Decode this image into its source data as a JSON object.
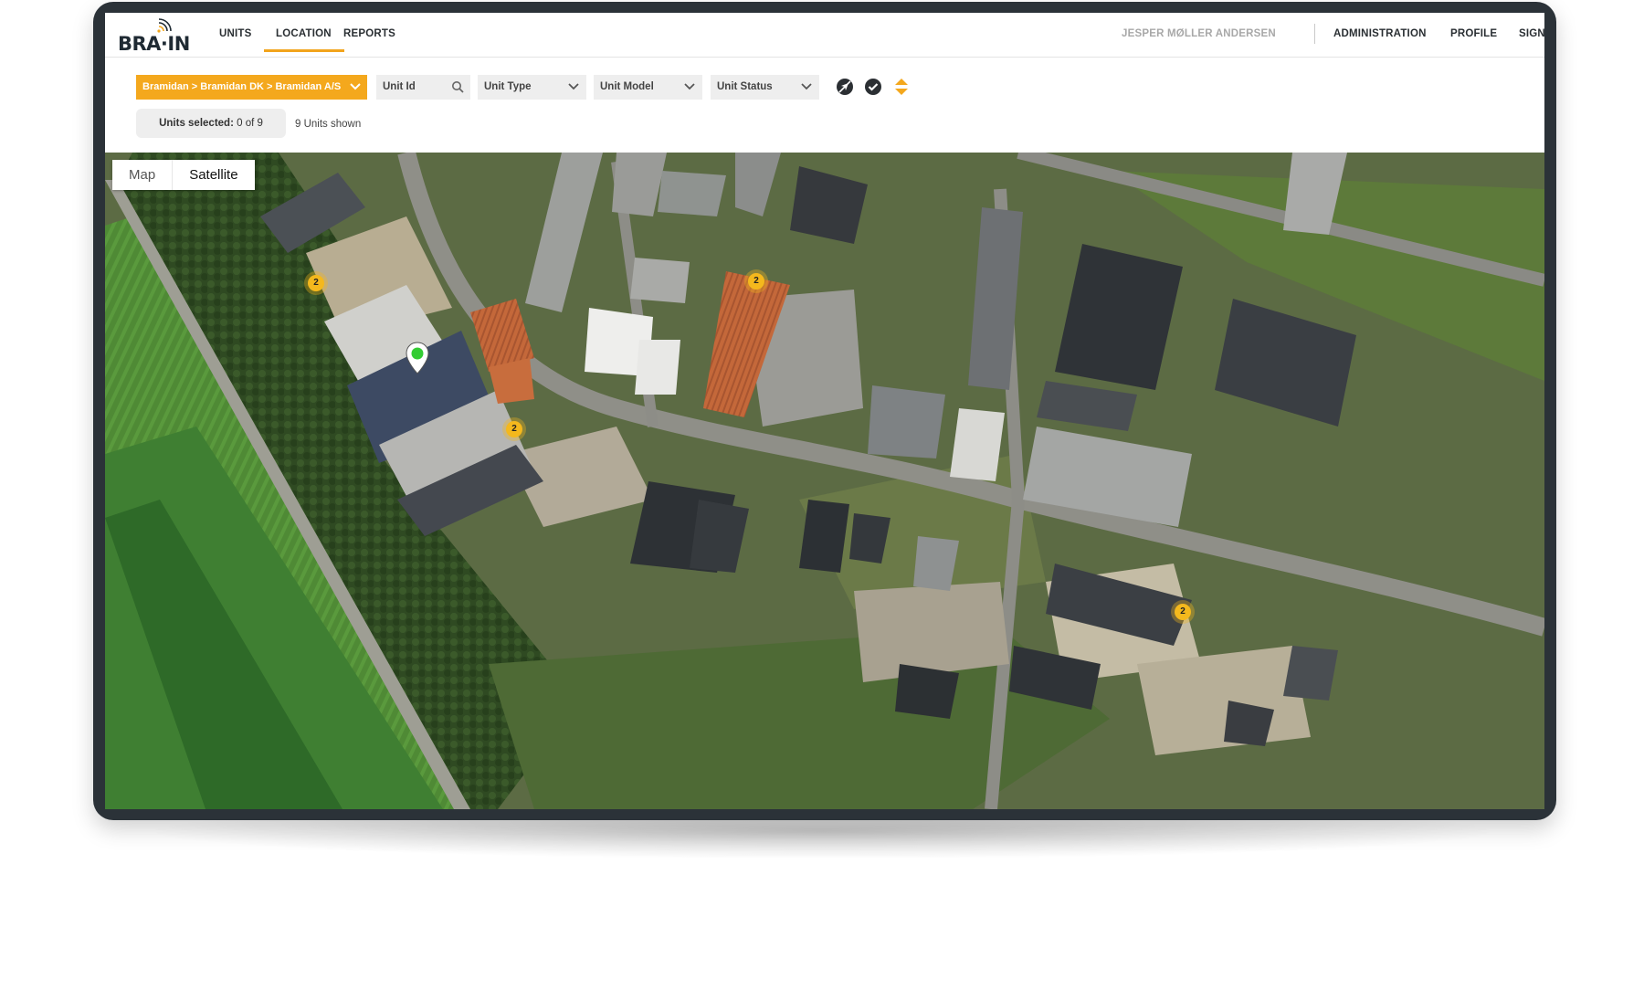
{
  "app": {
    "logo_text": "BRA·IN"
  },
  "nav": {
    "items": [
      {
        "label": "UNITS"
      },
      {
        "label": "LOCATION"
      },
      {
        "label": "REPORTS"
      }
    ],
    "active": "LOCATION",
    "user_name": "JESPER MØLLER ANDERSEN",
    "right_items": [
      {
        "label": "ADMINISTRATION"
      },
      {
        "label": "PROFILE"
      },
      {
        "label": "SIGN"
      }
    ]
  },
  "filters": {
    "breadcrumb": "Bramidan > Bramidan DK > Bramidan A/S",
    "unit_id": {
      "placeholder": "Unit Id"
    },
    "unit_type": "Unit Type",
    "unit_model": "Unit Model",
    "unit_status": "Unit Status",
    "icons": [
      "no-location-icon",
      "check-circle-icon",
      "sort-icon"
    ]
  },
  "selection": {
    "selected_label": "Units selected:",
    "selected_value": "0 of 9",
    "shown_text": "9 Units shown"
  },
  "map": {
    "type_buttons": [
      "Map",
      "Satellite"
    ],
    "active_type": "Satellite",
    "cluster_labels": [
      "2",
      "2",
      "2",
      "2"
    ],
    "marker_color": "#33cc33",
    "cluster_color": "#f4b81d"
  },
  "colors": {
    "accent": "#f4a81d",
    "frame": "#2b3238"
  }
}
